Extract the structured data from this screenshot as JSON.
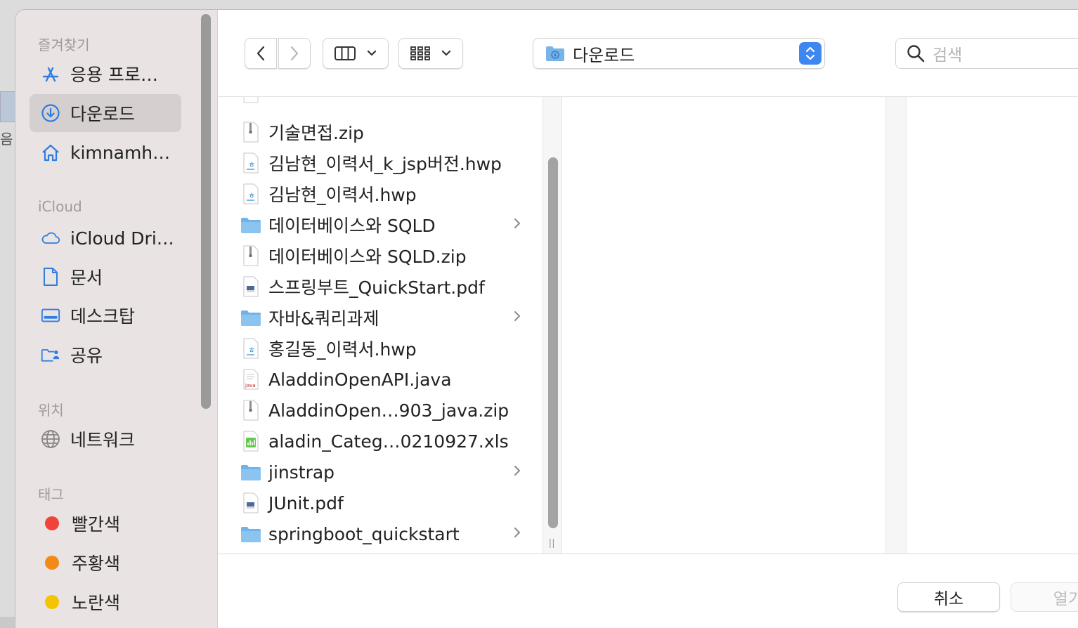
{
  "backdrop": {
    "partial_text": "음"
  },
  "sidebar": {
    "sections": [
      {
        "title": "즐겨찾기",
        "items": [
          {
            "label": "응용 프로…",
            "icon": "applications-icon"
          },
          {
            "label": "다운로드",
            "icon": "downloads-icon",
            "active": true
          },
          {
            "label": "kimnamh…",
            "icon": "home-icon"
          }
        ]
      },
      {
        "title": "iCloud",
        "items": [
          {
            "label": "iCloud Dri…",
            "icon": "icloud-icon"
          },
          {
            "label": "문서",
            "icon": "document-icon"
          },
          {
            "label": "데스크탑",
            "icon": "desktop-icon"
          },
          {
            "label": "공유",
            "icon": "shared-folder-icon"
          }
        ]
      },
      {
        "title": "위치",
        "items": [
          {
            "label": "네트워크",
            "icon": "network-icon"
          }
        ]
      },
      {
        "title": "태그",
        "items": [
          {
            "label": "빨간색",
            "color": "#f0433a"
          },
          {
            "label": "주황색",
            "color": "#f38a18"
          },
          {
            "label": "노란색",
            "color": "#f5c400"
          }
        ]
      }
    ]
  },
  "toolbar": {
    "location": "다운로드",
    "search_placeholder": "검색"
  },
  "files": [
    {
      "name": "기술면접.zip",
      "type": "zip"
    },
    {
      "name": "김남현_이력서_k_jsp버전.hwp",
      "type": "hwp"
    },
    {
      "name": "김남현_이력서.hwp",
      "type": "hwp"
    },
    {
      "name": "데이터베이스와 SQLD",
      "type": "folder"
    },
    {
      "name": "데이터베이스와 SQLD.zip",
      "type": "zip"
    },
    {
      "name": "스프링부트_QuickStart.pdf",
      "type": "pdf"
    },
    {
      "name": "자바&쿼리과제",
      "type": "folder"
    },
    {
      "name": "홍길동_이력서.hwp",
      "type": "hwp"
    },
    {
      "name": "AladdinOpenAPI.java",
      "type": "java"
    },
    {
      "name": "AladdinOpen…903_java.zip",
      "type": "zip"
    },
    {
      "name": "aladin_Categ…0210927.xls",
      "type": "xls"
    },
    {
      "name": "jinstrap",
      "type": "folder"
    },
    {
      "name": "JUnit.pdf",
      "type": "pdf"
    },
    {
      "name": "springboot_quickstart",
      "type": "folder"
    }
  ],
  "buttons": {
    "cancel": "취소",
    "open": "열기"
  },
  "colors": {
    "accent": "#3f87f0",
    "sidebar_bg": "#e9e3e3",
    "folder": "#6fb3ea"
  }
}
